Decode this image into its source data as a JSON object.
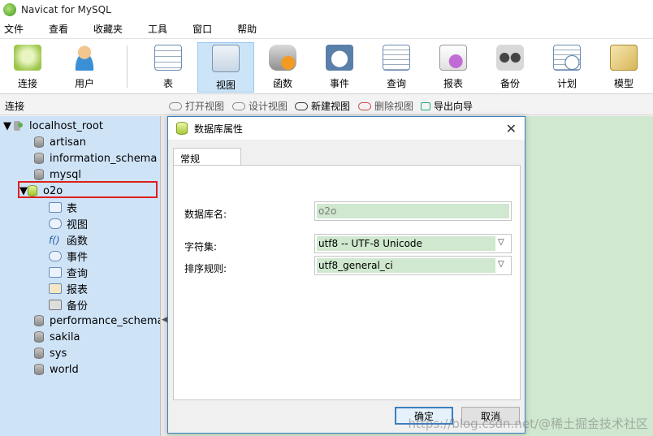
{
  "window": {
    "title": "Navicat for MySQL"
  },
  "menu": [
    "文件",
    "查看",
    "收藏夹",
    "工具",
    "窗口",
    "帮助"
  ],
  "toolbar": [
    {
      "label": "连接",
      "icon": "connect-icon"
    },
    {
      "label": "用户",
      "icon": "user-icon"
    },
    {
      "label": "表",
      "icon": "table-icon"
    },
    {
      "label": "视图",
      "icon": "view-icon",
      "active": true
    },
    {
      "label": "函数",
      "icon": "function-icon"
    },
    {
      "label": "事件",
      "icon": "event-icon"
    },
    {
      "label": "查询",
      "icon": "query-icon"
    },
    {
      "label": "报表",
      "icon": "report-icon"
    },
    {
      "label": "备份",
      "icon": "backup-icon"
    },
    {
      "label": "计划",
      "icon": "schedule-icon"
    },
    {
      "label": "模型",
      "icon": "model-icon"
    }
  ],
  "subbar": {
    "connection_label": "连接",
    "actions": [
      {
        "label": "打开视图"
      },
      {
        "label": "设计视图"
      },
      {
        "label": "新建视图"
      },
      {
        "label": "删除视图"
      },
      {
        "label": "导出向导"
      }
    ]
  },
  "tree": {
    "root": "localhost_root",
    "databases_before": [
      "artisan",
      "information_schema",
      "mysql"
    ],
    "selected_db": "o2o",
    "children": [
      "表",
      "视图",
      "函数",
      "事件",
      "查询",
      "报表",
      "备份"
    ],
    "databases_after": [
      "performance_schema",
      "sakila",
      "sys",
      "world"
    ]
  },
  "dialog": {
    "title": "数据库属性",
    "close_glyph": "✕",
    "tab": "常规",
    "db_name_label": "数据库名:",
    "db_name_value": "o2o",
    "charset_label": "字符集:",
    "charset_value": "utf8 -- UTF-8 Unicode",
    "collation_label": "排序规则:",
    "collation_value": "utf8_general_ci",
    "ok_label": "确定",
    "cancel_label": "取消"
  },
  "watermark": "https://blog.csdn.net/@稀土掘金技术社区",
  "colors": {
    "tree_bg": "#cfe3f7",
    "content_bg": "#cfe8cf",
    "active_tool": "#cce4f7",
    "highlight": "#e02020",
    "dialog_border": "#3b7fc4"
  }
}
